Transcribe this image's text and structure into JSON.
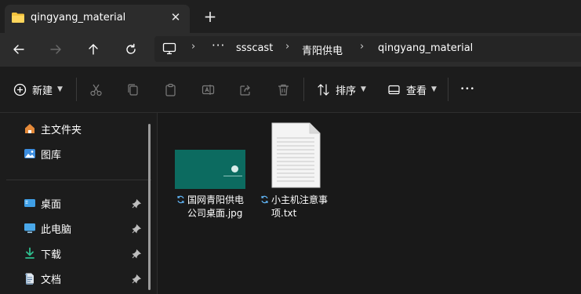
{
  "tab": {
    "title": "qingyang_material",
    "close_glyph": "✕",
    "new_tab_glyph": "+"
  },
  "nav": {
    "overflow": "···",
    "breadcrumbs": [
      "ssscast",
      "青阳供电",
      "qingyang_material"
    ]
  },
  "commands": {
    "new_label": "新建",
    "sort_label": "排序",
    "view_label": "查看",
    "more_glyph": "•••"
  },
  "sidebar": {
    "items": [
      {
        "label": "主文件夹",
        "icon": "home-icon"
      },
      {
        "label": "图库",
        "icon": "gallery-icon"
      },
      {
        "label": "桌面",
        "icon": "desktop-icon",
        "pinned": true
      },
      {
        "label": "此电脑",
        "icon": "this-pc-icon",
        "pinned": true
      },
      {
        "label": "下载",
        "icon": "download-icon",
        "pinned": true
      },
      {
        "label": "文档",
        "icon": "document-icon",
        "pinned": true
      }
    ]
  },
  "files": [
    {
      "name_line1": "国网青阳供电",
      "name_line2": "公司桌面.jpg",
      "type": "image"
    },
    {
      "name_line1": "小主机注意事",
      "name_line2": "项.txt",
      "type": "text"
    }
  ],
  "colors": {
    "background": "#191919",
    "tab_active": "#2c2c2c",
    "accent_folder": "#f4c33d",
    "sync_blue": "#5fb2f2",
    "thumbnail_green": "#0c6b60"
  }
}
